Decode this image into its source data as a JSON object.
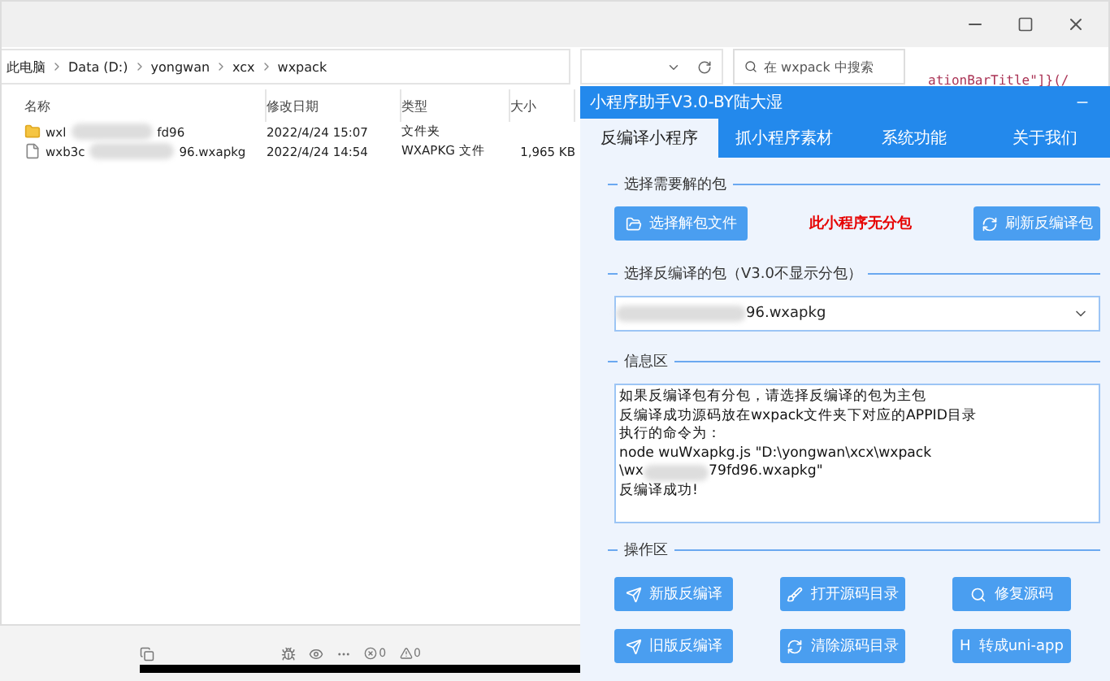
{
  "explorer": {
    "breadcrumb": [
      "此电脑",
      "Data (D:)",
      "yongwan",
      "xcx",
      "wxpack"
    ],
    "search": {
      "placeholder": "在 wxpack 中搜索"
    },
    "columns": [
      "名称",
      "修改日期",
      "类型",
      "大小"
    ],
    "files": [
      {
        "kind": "folder",
        "name_start": "wxl",
        "name_end": "fd96",
        "modified": "2022/4/24 15:07",
        "type": "文件夹"
      },
      {
        "kind": "file",
        "name_start": "wxb3c",
        "name_end": "96.wxapkg",
        "modified": "2022/4/24 14:54",
        "type": "WXAPKG 文件",
        "size": "1,965 KB"
      }
    ]
  },
  "editor": {
    "code_fragment": "ationBarTitle\"]}(/",
    "errors": "0",
    "warnings": "0"
  },
  "tool": {
    "title": "小程序助手V3.0-BY陆大湿",
    "tabs": [
      {
        "label": "反编译小程序",
        "selected": true
      },
      {
        "label": "抓小程序素材",
        "selected": false
      },
      {
        "label": "系统功能",
        "selected": false
      },
      {
        "label": "关于我们",
        "selected": false
      }
    ],
    "package_section": {
      "title": "选择需要解的包",
      "choose_button": "选择解包文件",
      "notice": "此小程序无分包",
      "refresh_button": "刷新反编译包"
    },
    "select_section": {
      "title": "选择反编译的包（V3.0不显示分包）",
      "value_end": "96.wxapkg"
    },
    "info_section": {
      "title": "信息区",
      "lines": [
        {
          "text": "如果反编译包有分包，请选择反编译的包为主包"
        },
        {
          "text": "反编译成功源码放在wxpack文件夹下对应的APPID目录"
        },
        {
          "text": "执行的命令为："
        },
        {
          "text": "node wuWxapkg.js \"D:\\yongwan\\xcx\\wxpack"
        },
        {
          "text": "\\wx",
          "text_end": "79fd96.wxapkg\""
        },
        {
          "text": "反编译成功!"
        }
      ]
    },
    "actions_section": {
      "title": "操作区",
      "buttons": [
        {
          "kind": "send",
          "label": "新版反编译"
        },
        {
          "kind": "brush",
          "label": "打开源码目录"
        },
        {
          "kind": "search",
          "label": "修复源码"
        },
        {
          "kind": "send",
          "label": "旧版反编译"
        },
        {
          "kind": "refresh",
          "label": "清除源码目录"
        },
        {
          "kind": "letter",
          "glyph": "H",
          "label": "转成uni-app"
        }
      ]
    }
  }
}
